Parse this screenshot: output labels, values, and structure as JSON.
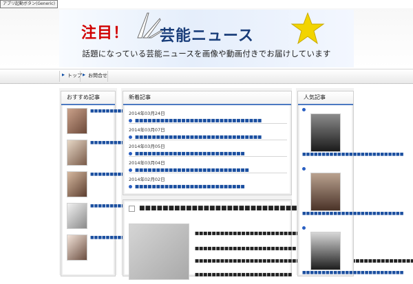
{
  "window": {
    "tab_label": "アプリ起動ボタン(Generic)"
  },
  "banner": {
    "title": "注目！",
    "subtitle": "芸能ニュース",
    "tagline": "話題になっている芸能ニュースを画像や動画付きでお届けしています"
  },
  "nav": {
    "items": [
      "トップ",
      "お問合せ"
    ]
  },
  "left_sidebar": {
    "heading": "おすすめ記事",
    "items": [
      {
        "text": "■■■■■■■■■■■■■■■■■■"
      },
      {
        "text": "■■■■■■■■■■■■■■■■■■■■"
      },
      {
        "text": "■■■■■■■■■■■■■■■■■■"
      },
      {
        "text": "■■■■■■■■■■■■■■■■■■"
      },
      {
        "text": "■■■■■■■■■■■■■■■■"
      }
    ]
  },
  "center": {
    "news": {
      "heading": "新着記事",
      "items": [
        {
          "date": "2014年03月24日",
          "title": "■■■■■■■■■■■■■■■■■■■■■■■■■■■■■■"
        },
        {
          "date": "2014年03月07日",
          "title": "■■■■■■■■■■■■■■■■■■■■■■■■■■■■■■"
        },
        {
          "date": "2014年03月05日",
          "title": "■■■■■■■■■■■■■■■■■■■■■■■■■■"
        },
        {
          "date": "2014年03月04日",
          "title": "■■■■■■■■■■■■■■■■■■■■■■■■■■■"
        },
        {
          "date": "2014年02月02日",
          "title": "■■■■■■■■■■■■■■■■■■■■■■■■■■"
        }
      ]
    },
    "article": {
      "title": "■■■■■■■■■■■■■■■■■■■■■■■■■■■■■■■■",
      "paragraphs": [
        "■■■■■■■■■■■■■■■■■■■■■■■■■■■■■■■■■■",
        "■■■■■■■■■■■■■■■■■■■■■■■■",
        "■■■■■■■■■■■■■■■■■■■■■■■■■■■■■■■■■■■■■■■■■■■■■■■■■■■■■■■",
        "■■■■■■■■■■■■■■■■■■■■■■■"
      ]
    }
  },
  "right_sidebar": {
    "heading": "人気記事",
    "items": [
      {
        "text": "■■■■■■■■■■■■■■■■■■■■■■■■■■"
      },
      {
        "text": "■■■■■■■■■■■■■■■■■■■■■■■■■■"
      },
      {
        "text": "■■■■■■■■■■■■■■■■■■■■■■■■■■"
      }
    ]
  },
  "colors": {
    "accent": "#4b79c1",
    "link": "#1b4fa0",
    "banner_red": "#d10000",
    "star": "#f2d400"
  }
}
